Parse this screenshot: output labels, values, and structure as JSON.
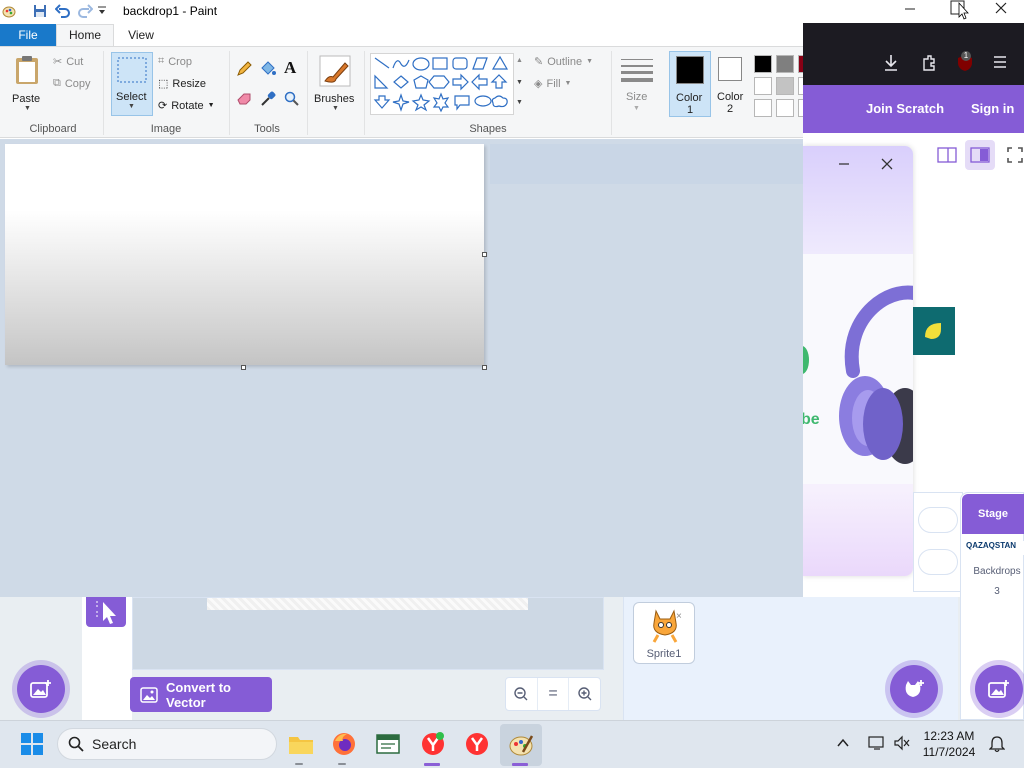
{
  "paint": {
    "title": "backdrop1 - Paint",
    "tabs": {
      "file": "File",
      "home": "Home",
      "view": "View"
    },
    "clipboard": {
      "paste": "Paste",
      "cut": "Cut",
      "copy": "Copy",
      "label": "Clipboard"
    },
    "image": {
      "select": "Select",
      "crop": "Crop",
      "resize": "Resize",
      "rotate": "Rotate",
      "label": "Image"
    },
    "tools": {
      "label": "Tools",
      "text_glyph": "A"
    },
    "brushes": "Brushes",
    "shapes": {
      "outline": "Outline",
      "fill": "Fill",
      "label": "Shapes"
    },
    "size": "Size",
    "color1": {
      "line1": "Color",
      "line2": "1"
    },
    "color2": {
      "line1": "Color",
      "line2": "2"
    },
    "palette": [
      "#000000",
      "#7f7f7f",
      "#880015",
      "#ffffff",
      "#c3c3c3",
      "#ffffff",
      "#ffffff",
      "#ffffff",
      "#ffffff"
    ],
    "accent": "#1979ca"
  },
  "browser": {
    "join_scratch": "Join Scratch",
    "sign_in": "Sign in",
    "notification_count": "1",
    "ad_text": "be",
    "accent": "#855cd6"
  },
  "scratch": {
    "convert_to_vector": "Convert to Vector",
    "zoom_reset": "=",
    "sprite_name": "Sprite1",
    "stage_label": "Stage",
    "stage_brand": "QAZAQSTAN",
    "backdrops_label": "Backdrops",
    "backdrops_count": "3",
    "accent": "#855cd6"
  },
  "taskbar": {
    "search_label": "Search",
    "time": "12:23 AM",
    "date": "11/7/2024"
  }
}
